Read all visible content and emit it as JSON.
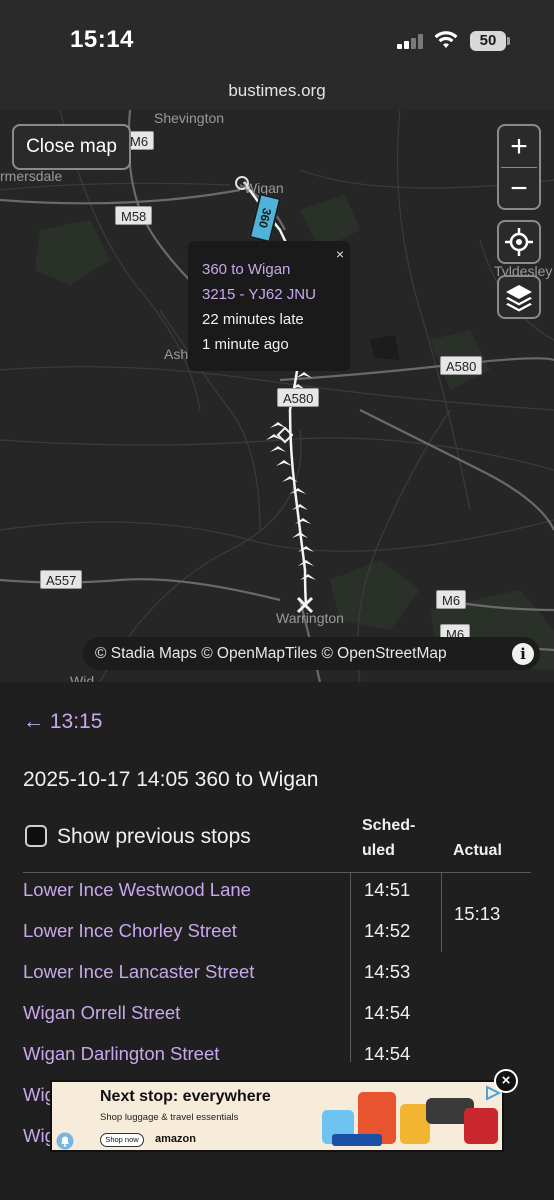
{
  "status_bar": {
    "time": "15:14",
    "battery": "50"
  },
  "browser": {
    "url": "bustimes.org"
  },
  "map": {
    "close_label": "Close map",
    "zoom_in": "+",
    "zoom_out": "−",
    "place_labels": [
      "Shevington",
      "rmersdale",
      "Wigan",
      "Tyldesley",
      "Ash",
      "Warrington",
      "Wid"
    ],
    "road_labels": [
      "M6",
      "M58",
      "A580",
      "A580",
      "A557",
      "M6",
      "M6"
    ],
    "popup": {
      "route": "360 to Wigan",
      "vehicle": "3215 - YJ62 JNU",
      "lateness": "22 minutes late",
      "updated": "1 minute ago",
      "close": "×"
    },
    "bus_label": "360",
    "attribution": "© Stadia Maps © OpenMapTiles © OpenStreetMap",
    "info_icon": "i"
  },
  "journey": {
    "back_label": "← 13:15",
    "title": "2025-10-17 14:05 360 to Wigan",
    "show_previous_label": "Show previous stops",
    "columns": {
      "scheduled_line1": "Sched-",
      "scheduled_line2": "uled",
      "actual": "Actual"
    },
    "stops": [
      {
        "name": "Lower Ince Westwood Lane",
        "scheduled": "14:51"
      },
      {
        "name": "Lower Ince Chorley Street",
        "scheduled": "14:52"
      },
      {
        "name": "Lower Ince Lancaster Street",
        "scheduled": "14:53"
      },
      {
        "name": "Wigan Orrell Street",
        "scheduled": "14:54"
      },
      {
        "name": "Wigan Darlington Street",
        "scheduled": "14:54"
      },
      {
        "name": "Wig",
        "scheduled": ""
      },
      {
        "name": "Wig",
        "scheduled": ""
      }
    ],
    "actual_time": "15:13"
  },
  "ad": {
    "headline": "Next stop: everywhere",
    "subline": "Shop luggage & travel essentials",
    "button": "Shop now",
    "brand": "amazon",
    "close": "×"
  },
  "colors": {
    "link": "#c9a7ec",
    "background": "#1f1f1f",
    "bus_tag": "#4fb3d9"
  }
}
